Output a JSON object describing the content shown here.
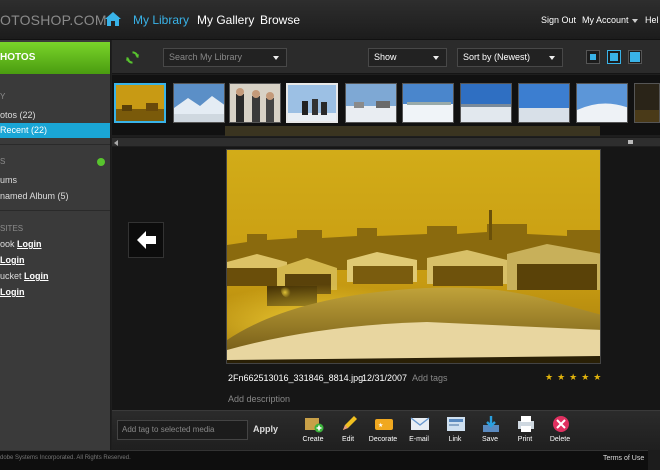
{
  "app": {
    "logo": "OTOSHOP.COM"
  },
  "nav": {
    "my_library": "My Library",
    "my_gallery": "My Gallery",
    "browse": "Browse",
    "sign_out": "Sign Out",
    "my_account": "My Account",
    "help": "Hel"
  },
  "sidebar": {
    "header": "HOTOS",
    "section1": "Y",
    "photos": "otos (22)",
    "recent": "Recent (22)",
    "section2": "S",
    "albums": "ums",
    "unnamed_album": "named Album (5)",
    "section3": "SITES",
    "site1_prefix": "ook",
    "site2_prefix": "",
    "site3_prefix": "ucket",
    "site4_prefix": "",
    "login": "Login"
  },
  "toolbar": {
    "search_placeholder": "Search My Library",
    "show_label": "Show",
    "sort_label": "Sort by (Newest)"
  },
  "filmstrip": {
    "thumbnails": [
      {
        "name": "thumb-night-town",
        "selected": "blue"
      },
      {
        "name": "thumb-mountain-snow",
        "selected": ""
      },
      {
        "name": "thumb-people-group",
        "selected": ""
      },
      {
        "name": "thumb-people-sky",
        "selected": "white"
      },
      {
        "name": "thumb-snow-village",
        "selected": ""
      },
      {
        "name": "thumb-snow-field",
        "selected": ""
      },
      {
        "name": "thumb-blue-sky",
        "selected": ""
      },
      {
        "name": "thumb-sky-panorama",
        "selected": ""
      },
      {
        "name": "thumb-snow-hill",
        "selected": ""
      },
      {
        "name": "thumb-dark-partial",
        "selected": ""
      }
    ]
  },
  "viewer": {
    "filename": "2Fn662513016_331846_8814.jpg",
    "date": "12/31/2007",
    "add_tags": "Add tags",
    "stars": "★★★★★",
    "add_description": "Add description"
  },
  "actions": {
    "tag_placeholder": "Add tag to selected media",
    "apply": "Apply",
    "create": "Create",
    "edit": "Edit",
    "decorate": "Decorate",
    "email": "E-mail",
    "link": "Link",
    "save": "Save",
    "print": "Print",
    "delete": "Delete"
  },
  "status": {
    "copyright": "dobe Systems Incorporated. All Rights Reserved.",
    "terms": "Terms of Use"
  },
  "colors": {
    "accent": "#39b3e8",
    "sidebar_green": "#5cb51c",
    "selected_row": "#1aa6d6",
    "star": "#e2b40c"
  }
}
